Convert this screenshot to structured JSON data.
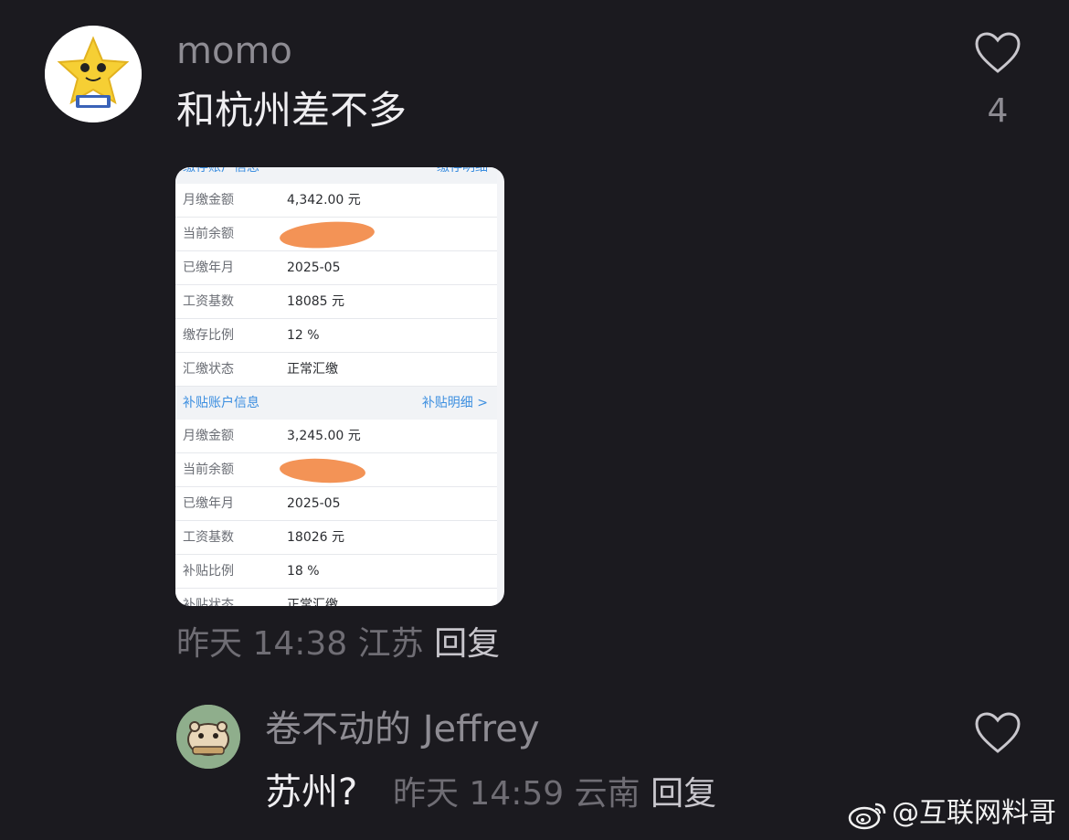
{
  "comment": {
    "username": "momo",
    "text": "和杭州差不多",
    "like_count": "4",
    "time": "昨天 14:38",
    "location": "江苏",
    "reply_label": "回复"
  },
  "attachment": {
    "top_section_title": "缴存账户信息",
    "top_section_link": "缴存明细",
    "top_rows": [
      {
        "label": "月缴金额",
        "value": "4,342.00 元"
      },
      {
        "label": "当前余额",
        "value": ""
      },
      {
        "label": "已缴年月",
        "value": "2025-05"
      },
      {
        "label": "工资基数",
        "value": "18085 元"
      },
      {
        "label": "缴存比例",
        "value": "12 %"
      },
      {
        "label": "汇缴状态",
        "value": "正常汇缴"
      }
    ],
    "sub_section_title": "补贴账户信息",
    "sub_section_link": "补贴明细 >",
    "sub_rows": [
      {
        "label": "月缴金额",
        "value": "3,245.00 元"
      },
      {
        "label": "当前余额",
        "value": ""
      },
      {
        "label": "已缴年月",
        "value": "2025-05"
      },
      {
        "label": "工资基数",
        "value": "18026 元"
      },
      {
        "label": "补贴比例",
        "value": "18 %"
      },
      {
        "label": "补贴状态",
        "value": "正常汇缴"
      }
    ],
    "redaction_color": "#f28a48"
  },
  "reply": {
    "username": "卷不动的 Jeffrey",
    "text": "苏州?",
    "time": "昨天 14:59",
    "location": "云南",
    "reply_label": "回复"
  },
  "watermark": {
    "text": "@互联网料哥",
    "icon": "weibo-logo-icon"
  },
  "colors": {
    "background": "#1b1a1f",
    "accent_link": "#3d8fe0"
  }
}
